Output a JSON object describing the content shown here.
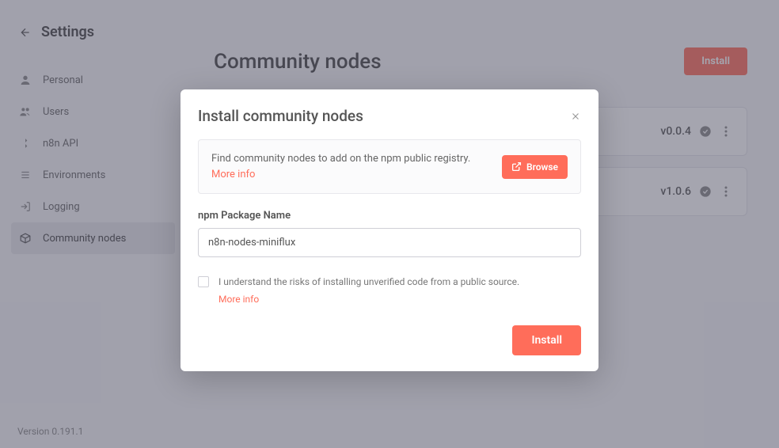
{
  "settings": {
    "title": "Settings",
    "nav": {
      "personal": "Personal",
      "users": "Users",
      "api": "n8n API",
      "environments": "Environments",
      "logging": "Logging",
      "community": "Community nodes"
    },
    "version": "Version 0.191.1"
  },
  "page": {
    "title": "Community nodes",
    "install_label": "Install"
  },
  "nodes": [
    {
      "version": "v0.0.4"
    },
    {
      "version": "v1.0.6"
    }
  ],
  "modal": {
    "title": "Install community nodes",
    "info_text_1": "Find community nodes to add on the npm public registry. ",
    "info_more": "More info",
    "browse_label": "Browse",
    "field_label": "npm Package Name",
    "input_value": "n8n-nodes-miniflux",
    "consent_text": "I understand the risks of installing unverified code from a public source.",
    "consent_more": "More info",
    "install_label": "Install"
  }
}
